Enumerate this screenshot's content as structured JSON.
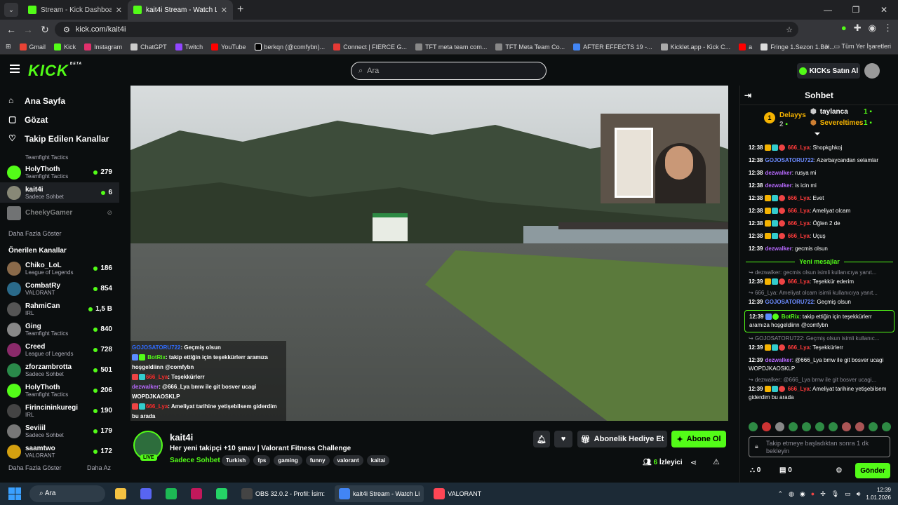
{
  "browser": {
    "tabs": [
      {
        "label": "Stream - Kick Dashboard",
        "active": false
      },
      {
        "label": "kait4i Stream - Watch Live o",
        "active": true
      }
    ],
    "url": "kick.com/kait4i",
    "bookmarks": [
      "Gmail",
      "Kick",
      "Instagram",
      "ChatGPT",
      "Twitch",
      "YouTube",
      "berkqn (@comfybn)...",
      "Connect | FIERCE G...",
      "TFT meta team com...",
      "TFT Meta Team Co...",
      "AFTER EFFECTS 19 -...",
      "Kicklet.app - Kick C...",
      "a",
      "Fringe 1.Sezon 1.Böl..."
    ],
    "bookmarks_right": "Tüm Yer İşaretleri"
  },
  "header": {
    "logo": "KICK",
    "logo_sup": "BETA",
    "search_placeholder": "Ara",
    "buy_kicks": "KICKs Satın Al"
  },
  "sidebar": {
    "nav": [
      {
        "label": "Ana Sayfa",
        "icon": "home-icon"
      },
      {
        "label": "Gözat",
        "icon": "browse-icon"
      },
      {
        "label": "Takip Edilen Kanallar",
        "icon": "heart-icon"
      }
    ],
    "followed": [
      {
        "name": "",
        "category": "Teamfight Tactics",
        "viewers": ""
      },
      {
        "name": "HolyThoth",
        "category": "Teamfight Tactics",
        "viewers": "279"
      },
      {
        "name": "kait4i",
        "category": "Sadece Sohbet",
        "viewers": "6"
      },
      {
        "name": "CheekyGamer",
        "category": "",
        "viewers": ""
      }
    ],
    "show_more": "Daha Fazla Göster",
    "recommended_title": "Önerilen Kanallar",
    "recommended": [
      {
        "name": "Chiko_LoL",
        "category": "League of Legends",
        "viewers": "186"
      },
      {
        "name": "CombatRy",
        "category": "VALORANT",
        "viewers": "854"
      },
      {
        "name": "RahmiCan",
        "category": "IRL",
        "viewers": "1,5 B"
      },
      {
        "name": "Ging",
        "category": "Teamfight Tactics",
        "viewers": "840"
      },
      {
        "name": "Creed",
        "category": "League of Legends",
        "viewers": "728"
      },
      {
        "name": "zforzambrotta",
        "category": "Sadece Sohbet",
        "viewers": "501"
      },
      {
        "name": "HolyThoth",
        "category": "Teamfight Tactics",
        "viewers": "206"
      },
      {
        "name": "Firincininkuregi",
        "category": "IRL",
        "viewers": "190"
      },
      {
        "name": "Seviiil",
        "category": "Sadece Sohbet",
        "viewers": "179"
      },
      {
        "name": "saamtwo",
        "category": "VALORANT",
        "viewers": "172"
      }
    ],
    "show_more_bottom": "Daha Fazla Göster",
    "show_less": "Daha Az"
  },
  "overlay_chat": [
    {
      "user": "GOJOSATORU722",
      "text": ": Geçmiş olsun"
    },
    {
      "user": "BotRix",
      "text": ": takip ettiğin için teşekkürlerr aramıza hoşgeldiinn @comfybn"
    },
    {
      "user": "666_Lya",
      "text": ": Teşekkürlerr"
    },
    {
      "user": "dezwalker",
      "text": ": @666_Lya bmw ile git bosver ucagi WOPDJKAOSKLP"
    },
    {
      "user": "666_Lya",
      "text": ": Ameliyat tarihine yetişebilsem giderdim bu arada"
    }
  ],
  "stream": {
    "streamer": "kait4i",
    "live": "LIVE",
    "title": "Her yeni takipçi +10 şınav | Valorant Fitness Challenge",
    "category": "Sadece Sohbet",
    "tags": [
      "Turkish",
      "fps",
      "gaming",
      "funny",
      "valorant",
      "kaitai"
    ],
    "gift_label": "Abonelik Hediye Et",
    "subscribe_label": "Abone Ol",
    "viewers": "6",
    "viewers_label": "İzleyici"
  },
  "chat": {
    "title": "Sohbet",
    "top_gifters": [
      {
        "name": "Delayys",
        "count": "2"
      },
      {
        "name": "taylanca",
        "count": "1"
      },
      {
        "name": "Severeltimes",
        "count": "1"
      }
    ],
    "messages": [
      {
        "time": "12:38",
        "user": "666_Lya",
        "color": "red",
        "text": ": Shopkghkoj"
      },
      {
        "time": "12:38",
        "user": "GOJOSATORU722",
        "color": "blue",
        "text": ": Azerbaycandan selamlar"
      },
      {
        "time": "12:38",
        "user": "dezwalker",
        "color": "purp",
        "text": ": rusya mi"
      },
      {
        "time": "12:38",
        "user": "dezwalker",
        "color": "purp",
        "text": ": is icin mi"
      },
      {
        "time": "12:38",
        "user": "666_Lya",
        "color": "red",
        "text": ": Evet"
      },
      {
        "time": "12:38",
        "user": "666_Lya",
        "color": "red",
        "text": ": Ameliyat olcam"
      },
      {
        "time": "12:38",
        "user": "666_Lya",
        "color": "red",
        "text": ": Öğlen 2 de"
      },
      {
        "time": "12:38",
        "user": "666_Lya",
        "color": "red",
        "text": ": Uçuş"
      },
      {
        "time": "12:39",
        "user": "dezwalker",
        "color": "purp",
        "text": ": gecmis olsun"
      }
    ],
    "new_messages_label": "Yeni mesajlar",
    "new_messages": [
      {
        "reply": "dezwalker: gecmis olsun isimli kullanıcıya yanıt...",
        "time": "12:39",
        "user": "666_Lya",
        "color": "red",
        "text": ": Teşekkür ederim"
      },
      {
        "reply": "666_Lya: Ameliyat olcam isimli kullanıcıya yanıt...",
        "time": "12:39",
        "user": "GOJOSATORU722",
        "color": "blue",
        "text": ": Geçmiş olsun"
      },
      {
        "reply": "",
        "time": "12:39",
        "user": "BotRix",
        "color": "green",
        "text": ": takip ettiğin için teşekkürlerr aramıza hoşgeldiinn @comfybn",
        "highlight": true
      },
      {
        "reply": "GOJOSATORU722: Geçmiş olsun isimli kullanıc...",
        "time": "12:39",
        "user": "666_Lya",
        "color": "red",
        "text": ": Teşekkürlerr"
      },
      {
        "reply": "",
        "time": "12:39",
        "user": "dezwalker",
        "color": "purp",
        "text": ": @666_Lya bmw ile git bosver ucagi WOPDJKAOSKLP"
      },
      {
        "reply": "dezwalker: @666_Lya bmw ile git bosver ucagi...",
        "time": "12:39",
        "user": "666_Lya",
        "color": "red",
        "text": ": Ameliyat tarihine yetişebilsem giderdim bu arada"
      }
    ],
    "input_placeholder": "Takip etmeye başladıktan sonra 1 dk bekleyin",
    "points": "0",
    "store_count": "0",
    "send_label": "Gönder"
  },
  "taskbar": {
    "search": "Ara",
    "apps": [
      {
        "label": "",
        "color": "#f5c242"
      },
      {
        "label": "",
        "color": "#5865f2"
      },
      {
        "label": "",
        "color": "#1db954"
      },
      {
        "label": "",
        "color": "#c2185b"
      },
      {
        "label": "",
        "color": "#25d366"
      },
      {
        "label": "OBS 32.0.2 - Profil: İsim:",
        "color": "#444"
      },
      {
        "label": "kait4i Stream - Watch Li",
        "color": "#4285f4",
        "active": true
      },
      {
        "label": "VALORANT",
        "color": "#ff4655"
      }
    ],
    "time": "12:39",
    "date": "1.01.2026"
  },
  "colors": {
    "kick_green": "#53fc18",
    "background": "#0b0e0f"
  }
}
